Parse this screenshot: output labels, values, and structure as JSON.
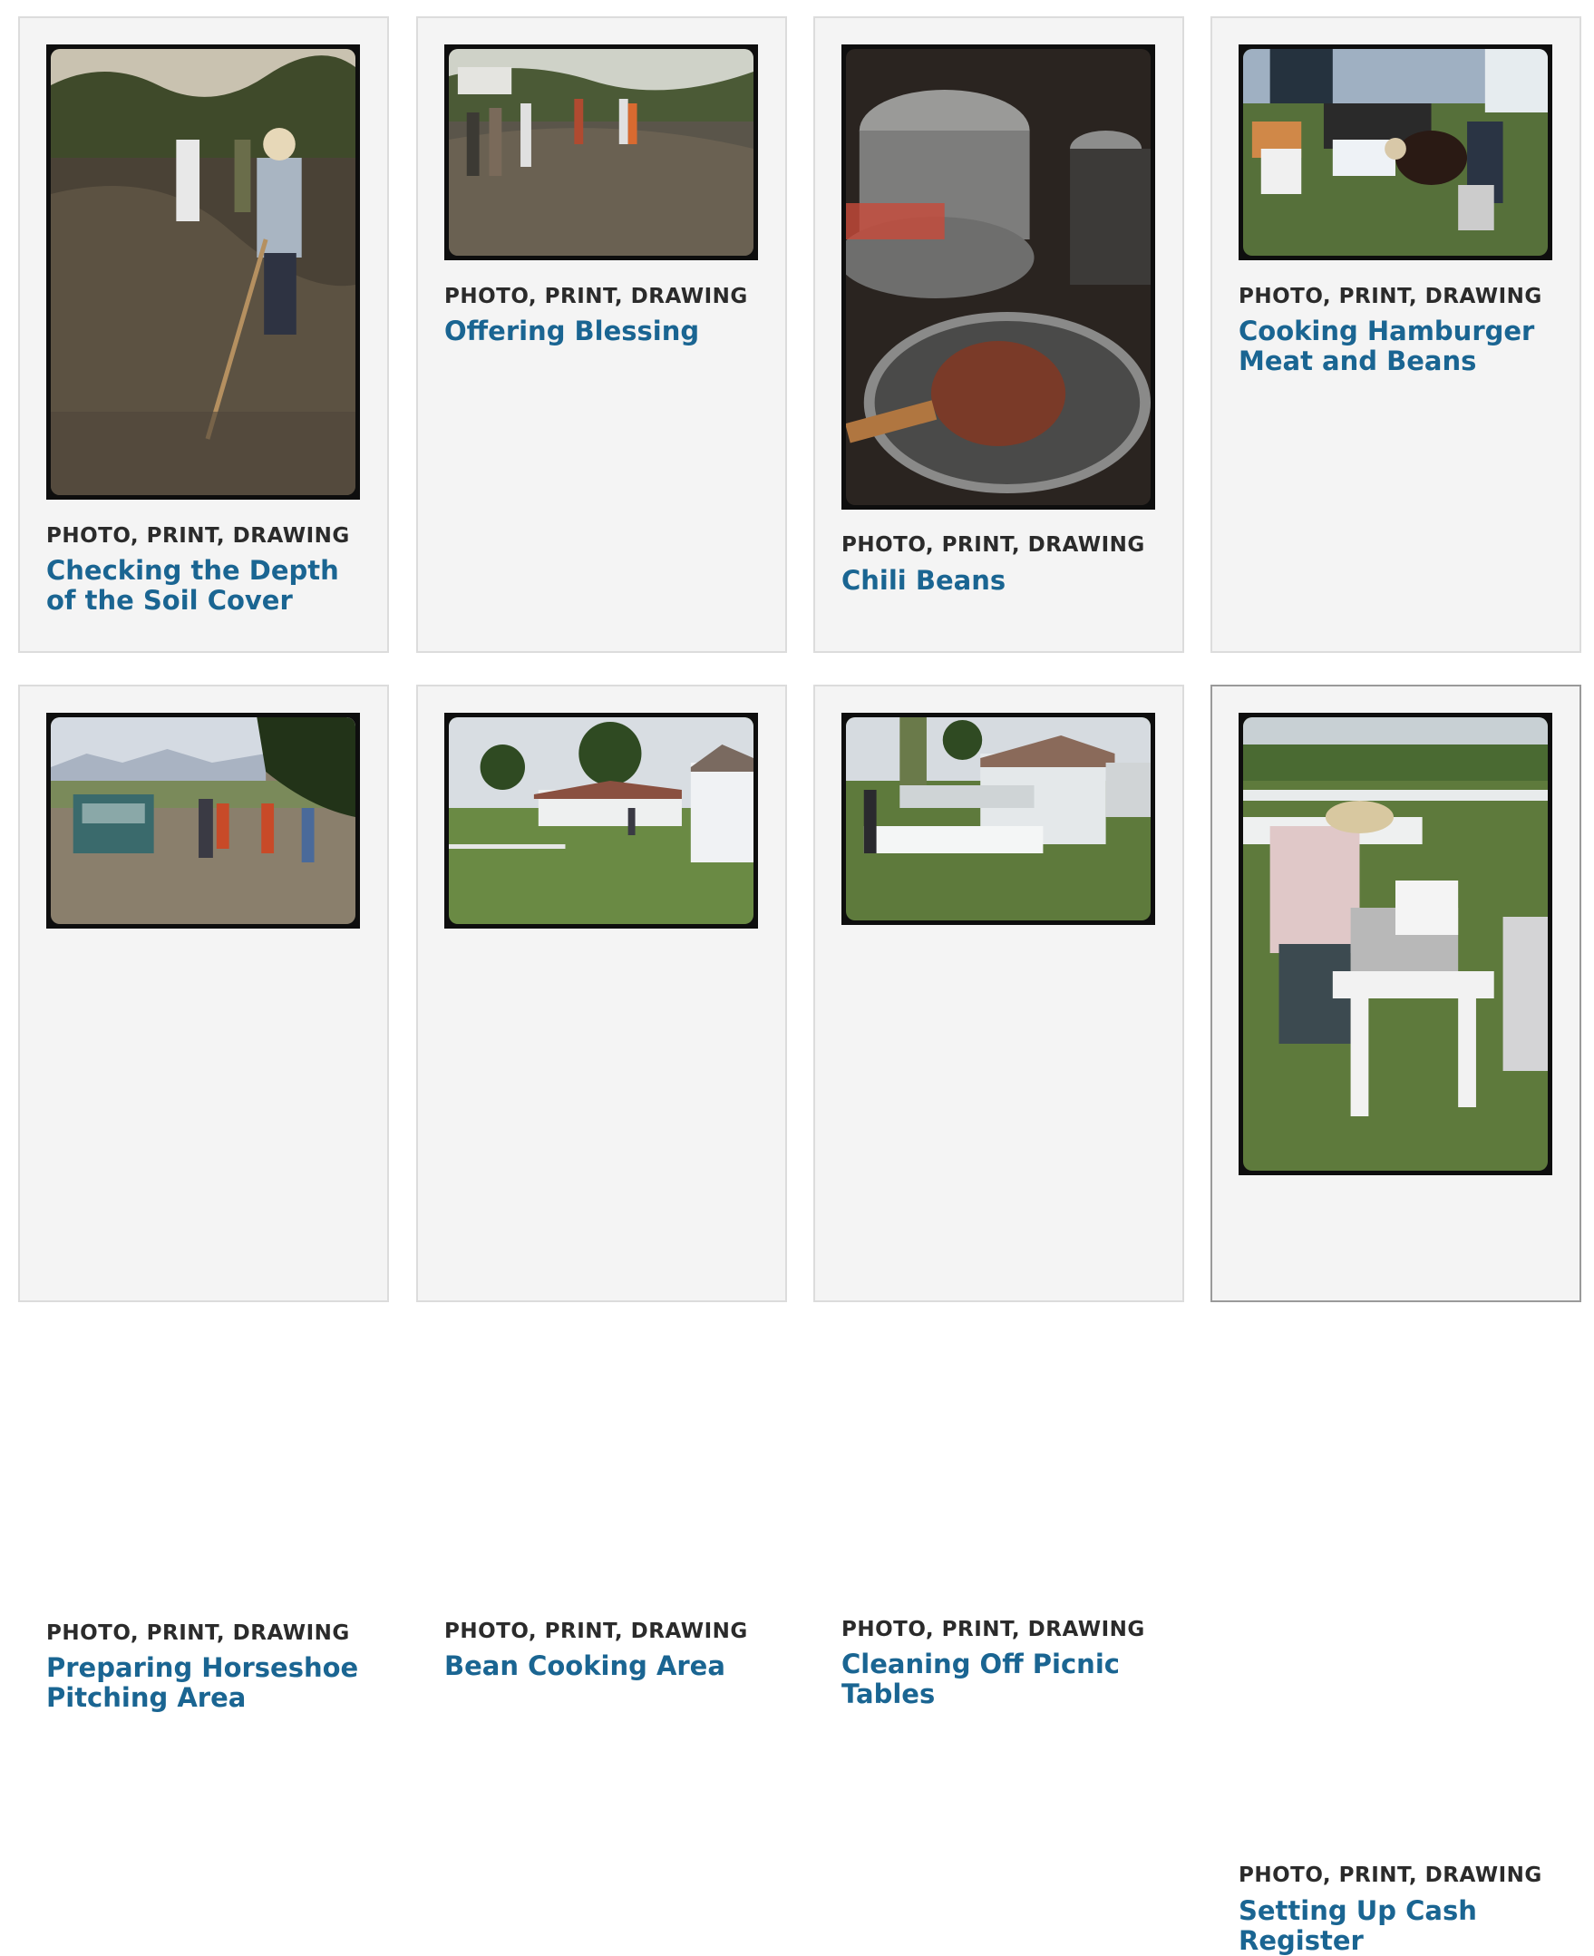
{
  "cards": [
    {
      "kind": "PHOTO, PRINT, DRAWING",
      "title": "Checking the Depth of the Soil Cover"
    },
    {
      "kind": "PHOTO, PRINT, DRAWING",
      "title": "Offering Blessing"
    },
    {
      "kind": "PHOTO, PRINT, DRAWING",
      "title": "Chili Beans"
    },
    {
      "kind": "PHOTO, PRINT, DRAWING",
      "title": "Cooking Hamburger Meat and Beans"
    },
    {
      "kind": "PHOTO, PRINT, DRAWING",
      "title": "Preparing Horseshoe Pitching Area"
    },
    {
      "kind": "PHOTO, PRINT, DRAWING",
      "title": "Bean Cooking Area"
    },
    {
      "kind": "PHOTO, PRINT, DRAWING",
      "title": "Cleaning Off Picnic Tables"
    },
    {
      "kind": "PHOTO, PRINT, DRAWING",
      "title": "Setting Up Cash Register"
    }
  ]
}
